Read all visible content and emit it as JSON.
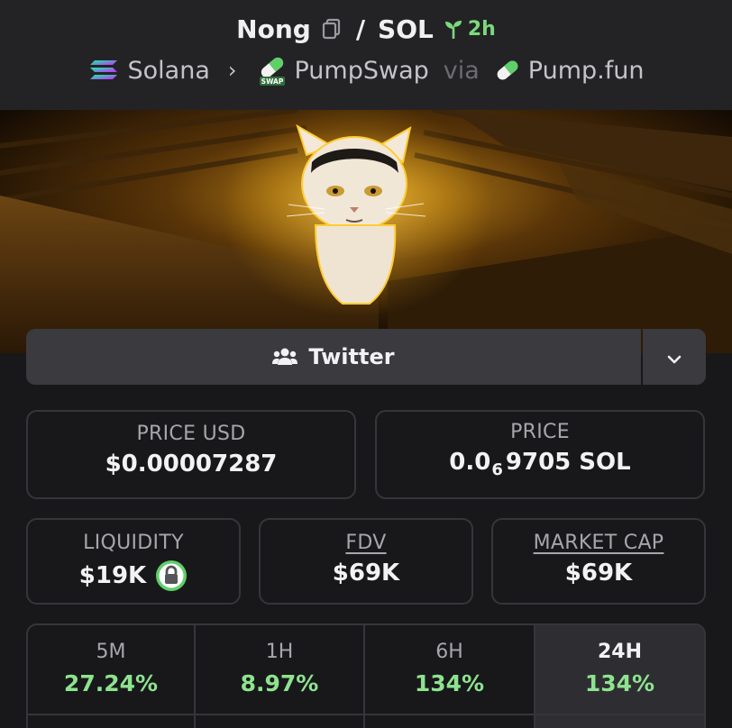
{
  "header": {
    "token": "Nong",
    "separator": "/",
    "quote": "SOL",
    "age": "2h",
    "chain": "Solana",
    "dex": "PumpSwap",
    "dex_badge": "SWAP",
    "via": "via",
    "launchpad": "Pump.fun"
  },
  "social": {
    "twitter_label": "Twitter",
    "more_icon": "chevron-down-icon"
  },
  "stats": {
    "price_usd_label": "PRICE USD",
    "price_usd_value": "$0.00007287",
    "price_label": "PRICE",
    "price_prefix": "0.0",
    "price_zero_count": "6",
    "price_suffix": "9705 SOL",
    "liquidity_label": "LIQUIDITY",
    "liquidity_value": "$19K",
    "fdv_label": "FDV",
    "fdv_value": "$69K",
    "mcap_label": "MARKET CAP",
    "mcap_value": "$69K"
  },
  "timeframes": [
    {
      "label": "5M",
      "change": "27.24%",
      "active": false
    },
    {
      "label": "1H",
      "change": "8.97%",
      "active": false
    },
    {
      "label": "6H",
      "change": "134%",
      "active": false
    },
    {
      "label": "24H",
      "change": "134%",
      "active": true
    }
  ],
  "colors": {
    "positive": "#8ee38e",
    "age": "#7cd97c",
    "lock": "#5fcf6a"
  }
}
